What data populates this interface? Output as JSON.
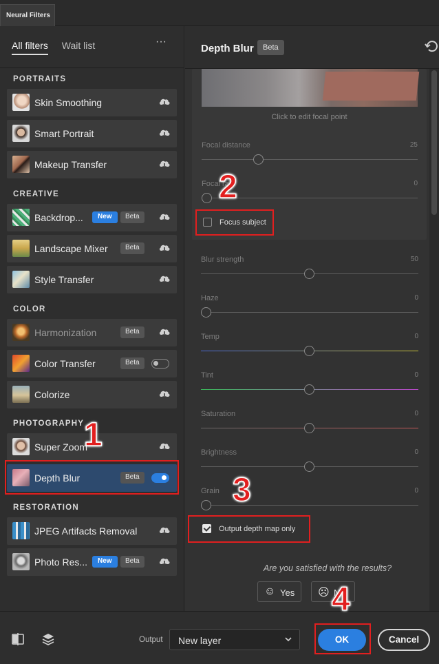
{
  "window": {
    "tab_title": "Neural Filters"
  },
  "left_panel": {
    "tabs": [
      "All filters",
      "Wait list"
    ],
    "more_label": "···",
    "sections": {
      "portraits": "PORTRAITS",
      "creative": "CREATIVE",
      "color": "COLOR",
      "photography": "PHOTOGRAPHY",
      "restoration": "RESTORATION"
    },
    "filters": [
      {
        "label": "Skin Smoothing"
      },
      {
        "label": "Smart Portrait"
      },
      {
        "label": "Makeup Transfer"
      },
      {
        "label": "Backdrop...",
        "new": "New",
        "beta": "Beta"
      },
      {
        "label": "Landscape Mixer",
        "beta": "Beta"
      },
      {
        "label": "Style Transfer"
      },
      {
        "label": "Harmonization",
        "beta": "Beta"
      },
      {
        "label": "Color Transfer",
        "beta": "Beta"
      },
      {
        "label": "Colorize"
      },
      {
        "label": "Super Zoom"
      },
      {
        "label": "Depth Blur",
        "beta": "Beta"
      },
      {
        "label": "JPEG Artifacts Removal"
      },
      {
        "label": "Photo Res...",
        "new": "New",
        "beta": "Beta"
      }
    ]
  },
  "right_panel": {
    "title": "Depth Blur",
    "beta": "Beta",
    "caption": "Click to edit focal point",
    "focal_distance": {
      "label": "Focal distance",
      "value": "25"
    },
    "focal_range": {
      "label": "Focal ra",
      "value": "0"
    },
    "focus_subject": "Focus subject",
    "blur_strength": {
      "label": "Blur strength",
      "value": "50"
    },
    "haze": {
      "label": "Haze",
      "value": "0"
    },
    "temp": {
      "label": "Temp",
      "value": "0"
    },
    "tint": {
      "label": "Tint",
      "value": "0"
    },
    "saturation": {
      "label": "Saturation",
      "value": "0"
    },
    "brightness": {
      "label": "Brightness",
      "value": "0"
    },
    "grain": {
      "label": "Grain",
      "value": "0"
    },
    "output_depth": "Output depth map only",
    "question": "Are you satisfied with the results?",
    "yes": "Yes",
    "no": "N"
  },
  "footer": {
    "output_label": "Output",
    "output_value": "New layer",
    "ok": "OK",
    "cancel": "Cancel"
  },
  "annotations": [
    "1",
    "2",
    "3",
    "4"
  ],
  "colors": {
    "accent": "#2b7fe0",
    "annotation": "#e21f1f"
  }
}
